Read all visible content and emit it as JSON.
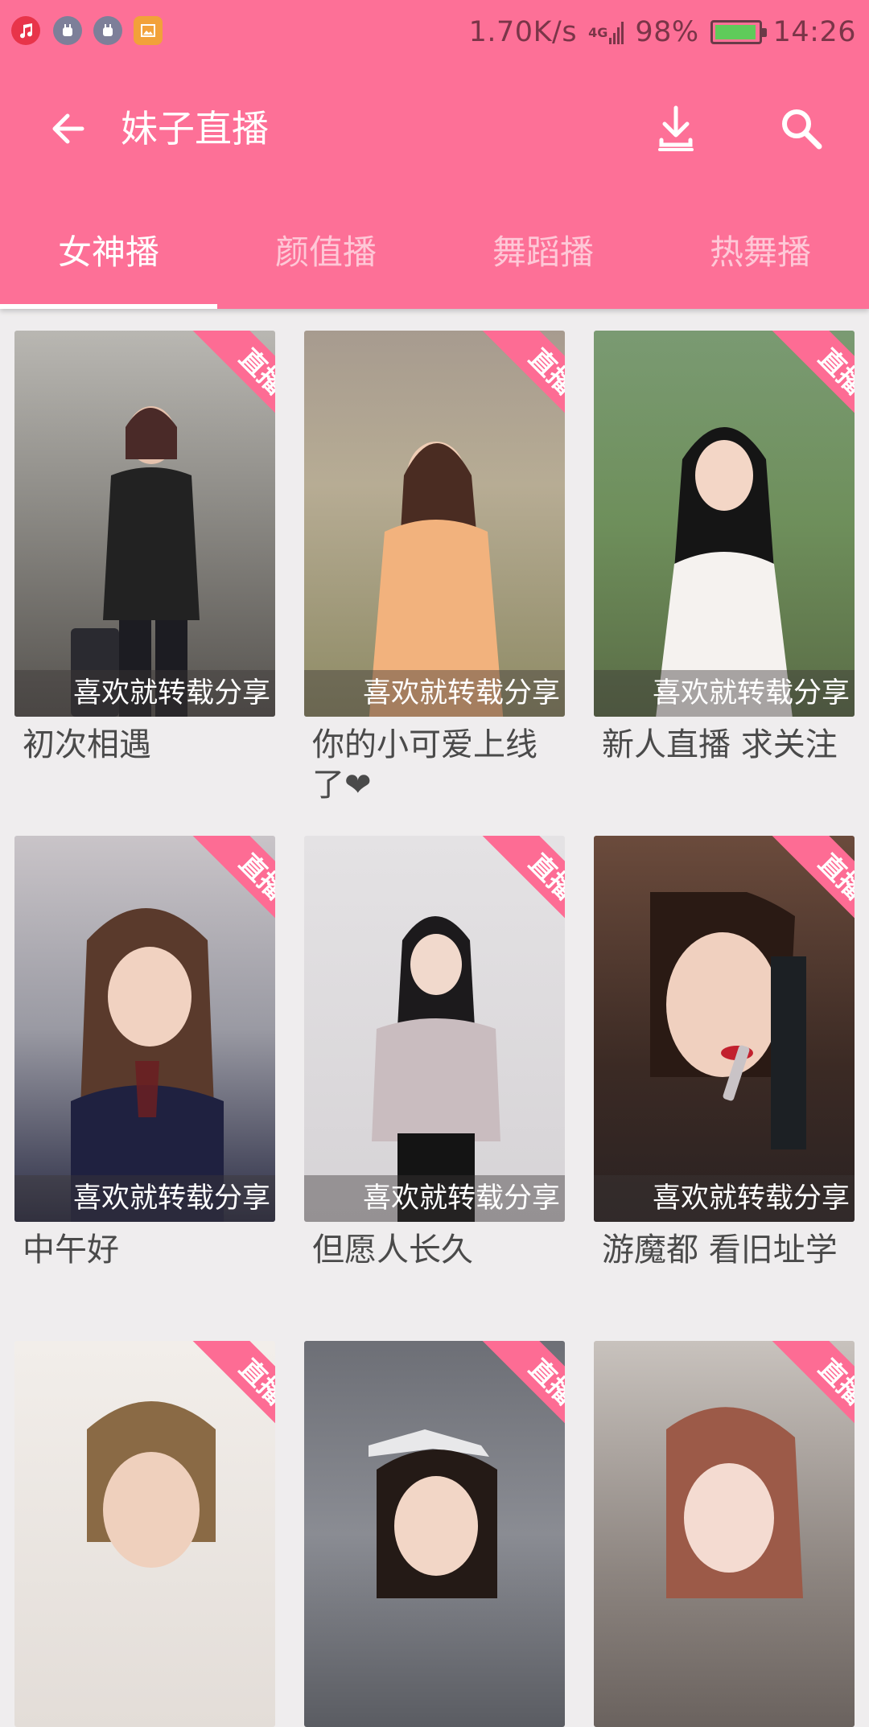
{
  "statusbar": {
    "speed": "1.70K/s",
    "network": "4G",
    "battery": "98%",
    "time": "14:26",
    "app_icons": [
      "music-app-icon",
      "android-debug-icon",
      "android-debug-icon",
      "image-app-icon"
    ]
  },
  "toolbar": {
    "title": "妹子直播",
    "back_icon": "arrow-left-icon",
    "download_icon": "download-icon",
    "search_icon": "search-icon"
  },
  "tabs": [
    {
      "label": "女神播",
      "active": true
    },
    {
      "label": "颜值播",
      "active": false
    },
    {
      "label": "舞蹈播",
      "active": false
    },
    {
      "label": "热舞播",
      "active": false
    }
  ],
  "cards": [
    {
      "badge": "直播",
      "caption": "喜欢就转载分享",
      "title": "初次相遇"
    },
    {
      "badge": "直播",
      "caption": "喜欢就转载分享",
      "title": "你的小可爱上线了❤"
    },
    {
      "badge": "直播",
      "caption": "喜欢就转载分享",
      "title": "新人直播 求关注"
    },
    {
      "badge": "直播",
      "caption": "喜欢就转载分享",
      "title": "中午好"
    },
    {
      "badge": "直播",
      "caption": "喜欢就转载分享",
      "title": "但愿人长久"
    },
    {
      "badge": "直播",
      "caption": "喜欢就转载分享",
      "title": "游魔都 看旧址学"
    },
    {
      "badge": "直播",
      "caption": "",
      "title": ""
    },
    {
      "badge": "直播",
      "caption": "",
      "title": ""
    },
    {
      "badge": "直播",
      "caption": "",
      "title": ""
    }
  ],
  "colors": {
    "primary": "#fd7097",
    "badge": "#fd6c94",
    "background": "#efedee",
    "title_text": "#4a4a4a"
  }
}
